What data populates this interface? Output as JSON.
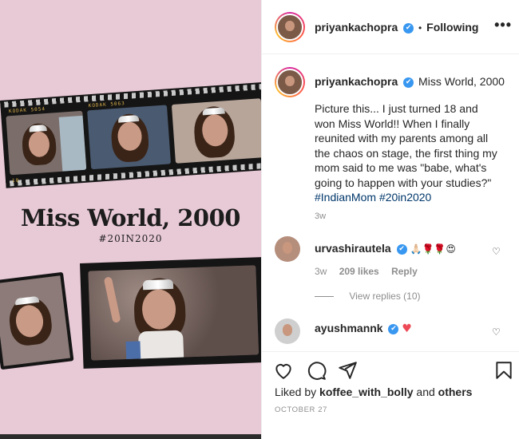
{
  "post": {
    "header": {
      "username": "priyankachopra",
      "verified_mark": "✔",
      "separator": "•",
      "follow_status": "Following",
      "more_options": "•••"
    },
    "image": {
      "title": "Miss World, 2000",
      "subtitle": "#20IN2020",
      "film_code_1": "KODAK 5054",
      "film_code_2": "KODAK 5063",
      "film_num": "10",
      "background_color": "#e8c9d6"
    },
    "caption": {
      "username": "priyankachopra",
      "verified_mark": "✔",
      "title_text": "Miss World, 2000",
      "body": "Picture this... I just turned 18 and won Miss World!! When I finally reunited with my parents among all the chaos on stage, the first thing my mom said to me was \"babe, what's going to happen with your studies?\"",
      "hashtag_1": "#IndianMom",
      "hashtag_2": "#20in2020",
      "time": "3w"
    },
    "comments": [
      {
        "username": "urvashirautela",
        "verified_mark": "✔",
        "text": "🙏🏻🌹🌹😍",
        "time": "3w",
        "likes": "209 likes",
        "reply": "Reply",
        "view_replies": "View replies (10)"
      },
      {
        "username": "ayushmannk",
        "verified_mark": "✔",
        "text": "♥"
      }
    ],
    "actions": {
      "like_icon": "heart-icon",
      "comment_icon": "comment-icon",
      "share_icon": "share-icon",
      "save_icon": "bookmark-icon"
    },
    "liked_by": {
      "prefix": "Liked by",
      "user": "koffee_with_bolly",
      "conjunction": "and",
      "others": "others"
    },
    "date": "OCTOBER 27",
    "colors": {
      "verified": "#3897f0",
      "hashtag": "#00376b",
      "heart_red": "#ed4956",
      "muted": "#8e8e8e"
    }
  }
}
